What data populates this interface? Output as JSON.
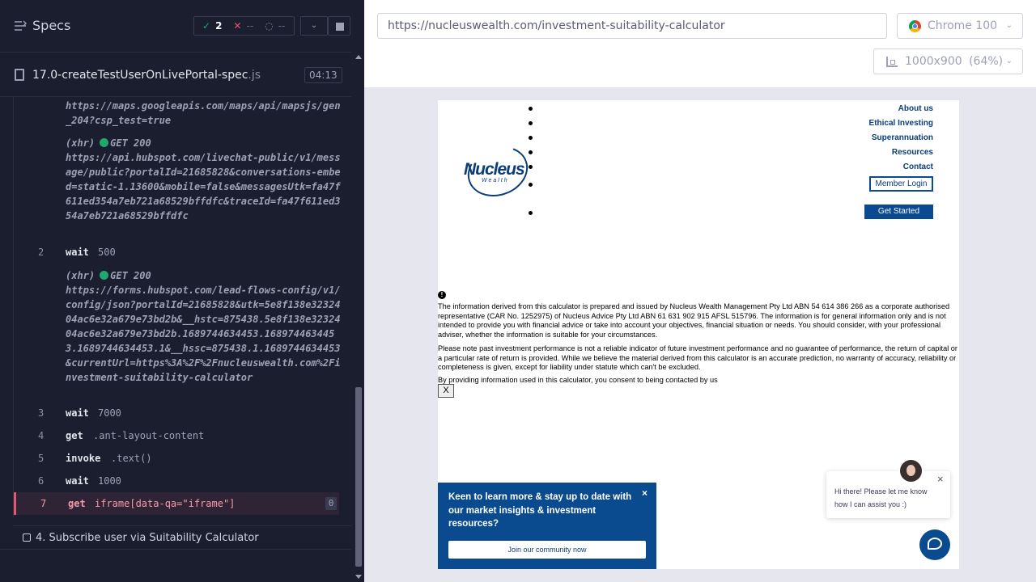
{
  "reporter": {
    "title": "Specs",
    "stats": {
      "passed": "2",
      "failed": "--",
      "pending": "--"
    },
    "spec_file": {
      "name": "17.0-createTestUserOnLivePortal-spec",
      "ext": ".js",
      "duration": "04:13"
    },
    "log": {
      "xhr1_tail": "https://maps.googleapis.com/maps/api/mapsjs/gen_204?csp_test=true",
      "xhr2_prefix": "(xhr)",
      "xhr2_method": "GET 200",
      "xhr2_url": "https://api.hubspot.com/livechat-public/v1/message/public?portalId=21685828&conversations-embed=static-1.13600&mobile=false&messagesUtk=fa47f611ed354a7eb721a68529bffdfc&traceId=fa47f611ed354a7eb721a68529bffdfc",
      "xhr3_prefix": "(xhr)",
      "xhr3_method": "GET 200",
      "xhr3_url": "https://forms.hubspot.com/lead-flows-config/v1/config/json?portalId=21685828&utk=5e8f138e3232404ac6e32a679e73bd2b&__hstc=875438.5e8f138e3232404ac6e32a679e73bd2b.1689744634453.1689744634453.1689744634453.1&__hssc=875438.1.1689744634453&currentUrl=https%3A%2F%2Fnucleuswealth.com%2Finvestment-suitability-calculator",
      "commands": [
        {
          "num": "2",
          "name": "wait",
          "arg": "500"
        },
        {
          "num": "3",
          "name": "wait",
          "arg": "7000"
        },
        {
          "num": "4",
          "name": "get",
          "arg": ".ant-layout-content"
        },
        {
          "num": "5",
          "name": "invoke",
          "arg": ".text()"
        },
        {
          "num": "6",
          "name": "wait",
          "arg": "1000"
        },
        {
          "num": "7",
          "name": "get",
          "arg": "iframe[data-qa=\"iframe\"]",
          "badge": "0"
        }
      ]
    },
    "next_test": "4. Subscribe user via Suitability Calculator"
  },
  "browser": {
    "url": "https://nucleuswealth.com/investment-suitability-calculator",
    "browser_name": "Chrome 100",
    "viewport": "1000x900",
    "scale": "(64%)"
  },
  "site": {
    "logo_text": "Nucleus",
    "logo_sub": "Wealth",
    "nav": [
      "About us",
      "Ethical Investing",
      "Superannuation",
      "Resources",
      "Contact"
    ],
    "member_login": "Member Login",
    "get_started": "Get Started",
    "disclaimer_1": "The information derived from this calculator is prepared and issued by Nucleus Wealth Management Pty Ltd ABN 54 614 386 266 as a corporate authorised representative (CAR No. 1252975) of Nucleus Advice Pty Ltd ABN 61 631 902 915 AFSL 515796. The information is for general information only and is not intended to provide you with financial advice or take into account your objectives, financial situation or needs. You should consider, with your professional adviser, whether the information is suitable for your circumstances.",
    "disclaimer_2": "Please note past investment performance is not a reliable indicator of future investment performance and no guarantee of performance, the return of capital or a particular rate of return is provided. While we believe the material derived from this calculator is an accurate prediction, no warranty of accuracy, reliability or completeness is given, except for liability under statute which can't be excluded.",
    "disclaimer_3": "By providing information used in this calculator, you consent to being contacted by us",
    "close_label": "X",
    "promo_text": "Keen to learn more & stay up to date with our market insights & investment resources?",
    "promo_button": "Join our community now",
    "promo_close": "×",
    "chat_text": "Hi there! Please let me know how I can assist you :)",
    "chat_close": "×"
  },
  "colors": {
    "pass": "#1fa971",
    "fail": "#e45770",
    "brand": "#0a4b8f"
  },
  "icons": [
    "specs-icon",
    "check-icon",
    "x-icon",
    "spinner-icon",
    "chevron-down-icon",
    "stop-icon",
    "file-icon",
    "chrome-icon",
    "ruler-icon",
    "info-icon",
    "chat-icon"
  ]
}
